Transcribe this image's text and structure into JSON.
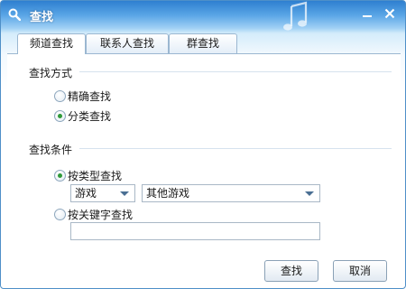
{
  "window": {
    "title": "查找",
    "icons": {
      "title": "search-icon",
      "decoration": "music-note-icon",
      "minimize": "minimize-icon",
      "close": "close-icon"
    }
  },
  "tabs": [
    {
      "label": "频道查找",
      "active": true
    },
    {
      "label": "联系人查找",
      "active": false
    },
    {
      "label": "群查找",
      "active": false
    }
  ],
  "search_mode": {
    "title": "查找方式",
    "options": [
      {
        "label": "精确查找",
        "checked": false
      },
      {
        "label": "分类查找",
        "checked": true
      }
    ]
  },
  "conditions": {
    "title": "查找条件",
    "by_type": {
      "label": "按类型查找",
      "checked": true
    },
    "category_select": {
      "value": "游戏"
    },
    "subcategory_select": {
      "value": "其他游戏"
    },
    "by_keyword": {
      "label": "按关键字查找",
      "checked": false
    },
    "keyword_input": {
      "value": ""
    }
  },
  "buttons": {
    "search": "查找",
    "cancel": "取消"
  },
  "colors": {
    "accent": "#2e7fd0",
    "radio_checked": "#2f9a3a"
  }
}
